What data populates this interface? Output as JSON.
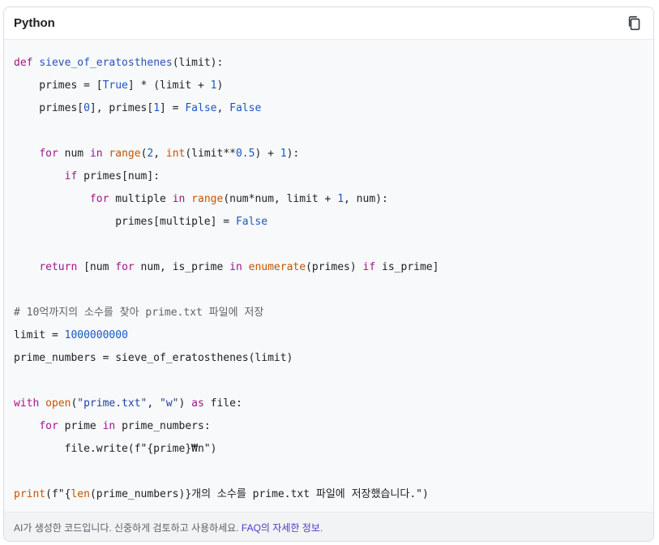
{
  "header": {
    "language": "Python",
    "copy_icon": "copy-icon"
  },
  "code": {
    "lines": [
      [
        [
          "kw",
          "def"
        ],
        [
          "t",
          " "
        ],
        [
          "fn",
          "sieve_of_eratosthenes"
        ],
        [
          "t",
          "(limit):"
        ]
      ],
      [
        [
          "t",
          "    primes = ["
        ],
        [
          "bool",
          "True"
        ],
        [
          "t",
          "] * (limit + "
        ],
        [
          "num",
          "1"
        ],
        [
          "t",
          ")"
        ]
      ],
      [
        [
          "t",
          "    primes["
        ],
        [
          "num",
          "0"
        ],
        [
          "t",
          "], primes["
        ],
        [
          "num",
          "1"
        ],
        [
          "t",
          "] = "
        ],
        [
          "bool",
          "False"
        ],
        [
          "t",
          ", "
        ],
        [
          "bool",
          "False"
        ]
      ],
      [],
      [
        [
          "t",
          "    "
        ],
        [
          "kw",
          "for"
        ],
        [
          "t",
          " num "
        ],
        [
          "kw",
          "in"
        ],
        [
          "t",
          " "
        ],
        [
          "bi",
          "range"
        ],
        [
          "t",
          "("
        ],
        [
          "num",
          "2"
        ],
        [
          "t",
          ", "
        ],
        [
          "bi",
          "int"
        ],
        [
          "t",
          "(limit**"
        ],
        [
          "num",
          "0.5"
        ],
        [
          "t",
          ") + "
        ],
        [
          "num",
          "1"
        ],
        [
          "t",
          "):"
        ]
      ],
      [
        [
          "t",
          "        "
        ],
        [
          "kw",
          "if"
        ],
        [
          "t",
          " primes[num]:"
        ]
      ],
      [
        [
          "t",
          "            "
        ],
        [
          "kw",
          "for"
        ],
        [
          "t",
          " multiple "
        ],
        [
          "kw",
          "in"
        ],
        [
          "t",
          " "
        ],
        [
          "bi",
          "range"
        ],
        [
          "t",
          "(num*num, limit + "
        ],
        [
          "num",
          "1"
        ],
        [
          "t",
          ", num):"
        ]
      ],
      [
        [
          "t",
          "                primes[multiple] = "
        ],
        [
          "bool",
          "False"
        ]
      ],
      [],
      [
        [
          "t",
          "    "
        ],
        [
          "kw",
          "return"
        ],
        [
          "t",
          " [num "
        ],
        [
          "kw",
          "for"
        ],
        [
          "t",
          " num, is_prime "
        ],
        [
          "kw",
          "in"
        ],
        [
          "t",
          " "
        ],
        [
          "bi",
          "enumerate"
        ],
        [
          "t",
          "(primes) "
        ],
        [
          "kw",
          "if"
        ],
        [
          "t",
          " is_prime]"
        ]
      ],
      [],
      [
        [
          "cmt",
          "# 10억까지의 소수를 찾아 prime.txt 파일에 저장"
        ]
      ],
      [
        [
          "t",
          "limit = "
        ],
        [
          "num",
          "1000000000"
        ]
      ],
      [
        [
          "t",
          "prime_numbers = sieve_of_eratosthenes(limit)"
        ]
      ],
      [],
      [
        [
          "kw",
          "with"
        ],
        [
          "t",
          " "
        ],
        [
          "bi",
          "open"
        ],
        [
          "t",
          "("
        ],
        [
          "str",
          "\"prime.txt\""
        ],
        [
          "t",
          ", "
        ],
        [
          "str",
          "\"w\""
        ],
        [
          "t",
          ") "
        ],
        [
          "kw",
          "as"
        ],
        [
          "t",
          " file:"
        ]
      ],
      [
        [
          "t",
          "    "
        ],
        [
          "kw",
          "for"
        ],
        [
          "t",
          " prime "
        ],
        [
          "kw",
          "in"
        ],
        [
          "t",
          " prime_numbers:"
        ]
      ],
      [
        [
          "t",
          "        file.write(f\"{prime}₩n\")"
        ]
      ],
      [],
      [
        [
          "bi",
          "print"
        ],
        [
          "t",
          "(f\"{"
        ],
        [
          "bi",
          "len"
        ],
        [
          "t",
          "(prime_numbers)}개의 소수를 prime.txt 파일에 저장했습니다.\")"
        ]
      ]
    ]
  },
  "footer": {
    "text": "AI가 생성한 코드입니다. 신중하게 검토하고 사용하세요. ",
    "link": "FAQ의 자세한 정보",
    "suffix": "."
  },
  "colors": {
    "keyword": "#a0158b",
    "builtin": "#c45500",
    "number": "#1a56c4",
    "link": "#4b3cc4"
  }
}
